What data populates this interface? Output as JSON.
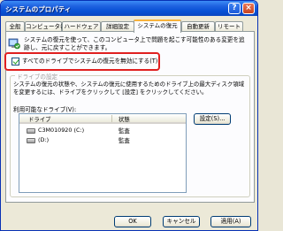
{
  "window": {
    "title": "システムのプロパティ",
    "help_glyph": "?",
    "close_glyph": "×"
  },
  "tabs": [
    {
      "label": "全般"
    },
    {
      "label": "コンピュータ名"
    },
    {
      "label": "ハードウェア"
    },
    {
      "label": "詳細設定"
    },
    {
      "label": "システムの復元",
      "active": true
    },
    {
      "label": "自動更新"
    },
    {
      "label": "リモート"
    }
  ],
  "intro": {
    "text": "システムの復元を使って、このコンピュータ上で問題を起こす可能性のある変更を追跡し、元に戻すことができます。"
  },
  "disable_checkbox": {
    "label": "すべてのドライブでシステムの復元を無効にする(T)",
    "checked": true
  },
  "drive_settings": {
    "legend": "ドライブの設定",
    "description": "システムの復元の状態や、システムの復元に使用するためのドライブ上の最大ディスク領域を変更するには、ドライブをクリックして [設定] をクリックしてください。",
    "available_label": "利用可能なドライブ(V):",
    "columns": [
      "ドライブ",
      "状態"
    ],
    "drives": [
      {
        "name": "C3M010920 (C:)",
        "status": "監査"
      },
      {
        "name": "(D:)",
        "status": "監査"
      }
    ],
    "settings_button": "設定(S)..."
  },
  "footer": {
    "ok": "OK",
    "cancel": "キャンセル",
    "apply": "適用(A)"
  },
  "colors": {
    "titlebar": "#0650d4",
    "highlight_box": "#e02020",
    "active_tab_accent": "#f8b23b"
  }
}
